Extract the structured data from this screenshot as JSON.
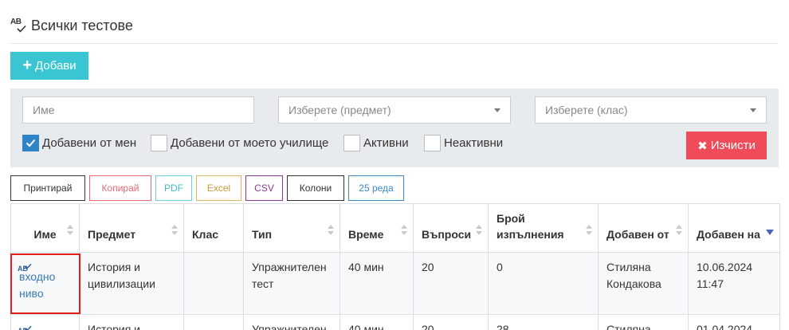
{
  "header": {
    "title": "Всички тестове",
    "icon": "ab-check-icon"
  },
  "toolbar": {
    "add_label": "Добави"
  },
  "filters": {
    "name_placeholder": "Име",
    "subject_placeholder": "Изберете (предмет)",
    "class_placeholder": "Изберете (клас)",
    "checkboxes": [
      {
        "label": "Добавени от мен",
        "checked": true
      },
      {
        "label": "Добавени от моето училище",
        "checked": false
      },
      {
        "label": "Активни",
        "checked": false
      },
      {
        "label": "Неактивни",
        "checked": false
      }
    ],
    "clear_label": "Изчисти"
  },
  "export": {
    "print": "Принтирай",
    "copy": "Копирай",
    "pdf": "PDF",
    "excel": "Excel",
    "csv": "CSV",
    "columns": "Колони",
    "rows": "25 реда"
  },
  "table": {
    "headers": [
      "Име",
      "Предмет",
      "Клас",
      "Тип",
      "Време",
      "Въпроси",
      "Брой изпълнения",
      "Добавен от",
      "Добавен на"
    ],
    "rows": [
      {
        "name": "входно ниво",
        "subject": "История и цивилизации",
        "class": "",
        "type": "Упражнителен тест",
        "time": "40 мин",
        "questions": "20",
        "runs": "0",
        "author": "Стиляна Кондакова",
        "date": "10.06.2024 11:47"
      },
      {
        "name": "",
        "subject": "История и",
        "class": "",
        "type": "Упражнителен",
        "time": "40 мин",
        "questions": "20",
        "runs": "28",
        "author": "Стиляна",
        "date": "01.04.2024"
      }
    ]
  },
  "colors": {
    "accent": "#39c5d2",
    "danger": "#ef4b58",
    "link": "#3a7ab4",
    "checkbox": "#2e84c6"
  }
}
